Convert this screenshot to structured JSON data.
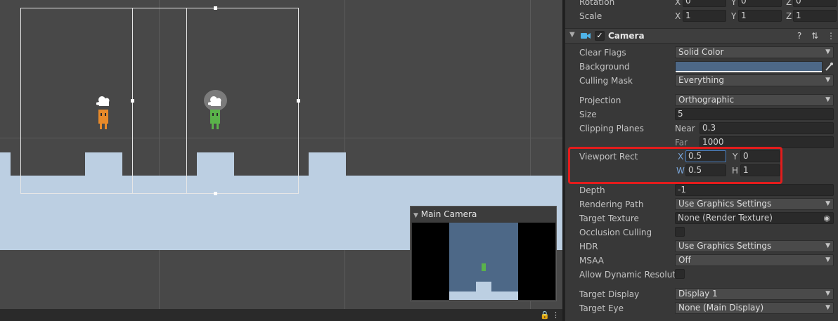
{
  "scene": {
    "preview_title": "Main Camera"
  },
  "inspector": {
    "transform": {
      "rotation_label": "Rotation",
      "rotation": {
        "x": "0",
        "y": "0",
        "z": "0"
      },
      "scale_label": "Scale",
      "scale": {
        "x": "1",
        "y": "1",
        "z": "1"
      },
      "axis_x": "X",
      "axis_y": "Y",
      "axis_z": "Z"
    },
    "camera": {
      "title": "Camera",
      "enabled_mark": "✓",
      "help_icon": "?",
      "settings_icon": "⇅",
      "menu_icon": "⋮",
      "clear_flags_label": "Clear Flags",
      "clear_flags_value": "Solid Color",
      "background_label": "Background",
      "background_color": "#4d6887",
      "culling_mask_label": "Culling Mask",
      "culling_mask_value": "Everything",
      "projection_label": "Projection",
      "projection_value": "Orthographic",
      "size_label": "Size",
      "size_value": "5",
      "clipping_label": "Clipping Planes",
      "near_label": "Near",
      "near_value": "0.3",
      "far_label": "Far",
      "far_value": "1000",
      "viewport_label": "Viewport Rect",
      "viewport": {
        "x_label": "X",
        "x": "0.5",
        "y_label": "Y",
        "y": "0",
        "w_label": "W",
        "w": "0.5",
        "h_label": "H",
        "h": "1"
      },
      "depth_label": "Depth",
      "depth_value": "-1",
      "rendering_path_label": "Rendering Path",
      "rendering_path_value": "Use Graphics Settings",
      "target_texture_label": "Target Texture",
      "target_texture_value": "None (Render Texture)",
      "occlusion_label": "Occlusion Culling",
      "hdr_label": "HDR",
      "hdr_value": "Use Graphics Settings",
      "msaa_label": "MSAA",
      "msaa_value": "Off",
      "dynamic_res_label": "Allow Dynamic Resolutio",
      "target_display_label": "Target Display",
      "target_display_value": "Display 1",
      "target_eye_label": "Target Eye",
      "target_eye_value": "None (Main Display)"
    },
    "dropdown_arrow": "▼",
    "highlight_color": "#e31c1c"
  }
}
